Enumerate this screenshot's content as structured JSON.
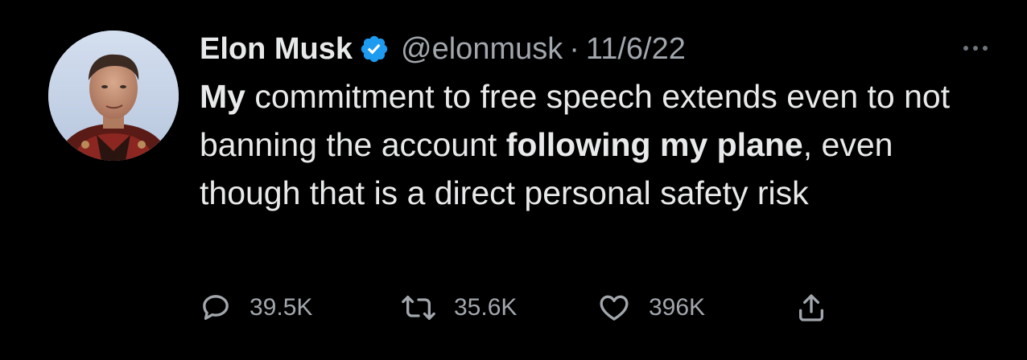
{
  "author": {
    "display_name": "Elon Musk",
    "handle": "@elonmusk",
    "separator": "·",
    "date": "11/6/22",
    "verified": true
  },
  "tweet": {
    "segments": [
      {
        "text": "My",
        "bold": true
      },
      {
        "text": " commitment to free speech extends even to not banning the account ",
        "bold": false
      },
      {
        "text": "following my plane",
        "bold": true
      },
      {
        "text": ", even though that is a direct personal safety risk",
        "bold": false
      }
    ],
    "seg_0": "My",
    "seg_1": " commitment to free speech extends even to not banning the account ",
    "seg_2": "following my plane",
    "seg_3": ", even though that is a direct personal safety risk"
  },
  "actions": {
    "replies": "39.5K",
    "retweets": "35.6K",
    "likes": "396K"
  },
  "icons": {
    "verified": "verified-badge-icon",
    "more": "more-options-icon",
    "reply": "reply-icon",
    "retweet": "retweet-icon",
    "like": "heart-icon",
    "share": "share-icon"
  },
  "colors": {
    "background": "#000000",
    "primary_text": "#e7e9ea",
    "secondary_text": "#a2a7ad",
    "verified_blue": "#1d9bf0"
  }
}
